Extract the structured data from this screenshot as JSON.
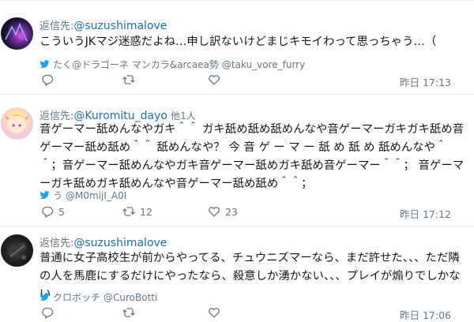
{
  "tweets": [
    {
      "reply_prefix": "返信先:",
      "reply_handle": "@suzushimalove",
      "reply_more": "",
      "text": "こういうJKマジ迷惑だよね…申し訳ないけどまじキモイわって思っちゃう…（",
      "source_name": "たく@ドラゴーネ マンカラ&arcaea勢",
      "source_handle": "@taku_vore_furry",
      "reply_count": "",
      "retweet_count": "",
      "like_count": "",
      "time": "昨日 17:13"
    },
    {
      "reply_prefix": "返信先:",
      "reply_handle": "@Kuromitu_dayo",
      "reply_more": "他1人",
      "text": "音ゲーマー舐めんなやガキ＾＾ ガキ舐め舐め舐めんなや音ゲーマーガキガキ舐め音ゲーマー舐め舐め＾＾ 舐めんなや？ 今 音 ゲ ー マ ー 舐 め 舐 め 舐めんなや＾＾；音ゲーマー舐めんなやガキ音ゲーマー舐めガキ舐め音ゲーマー＾＾； 音ゲーマーガキ舐めガキ舐めんなや音ゲーマー舐め舐め＾＾；",
      "source_name": "う",
      "source_handle": "@M0mijI_A0I",
      "reply_count": "5",
      "retweet_count": "12",
      "like_count": "23",
      "time": "昨日 17:12"
    },
    {
      "reply_prefix": "返信先:",
      "reply_handle": "@suzushimalove",
      "reply_more": "",
      "text": "普通に女子高校生が前からやってる、チュウニズマーなら、まだ許せた、、、ただ隣の人を馬鹿にするだけにやったなら、殺意しか湧かない、、、プレイが煽りでしかない",
      "source_name": "クロボッチ",
      "source_handle": "@CuroBotti",
      "reply_count": "",
      "retweet_count": "",
      "like_count": "",
      "time": "昨日 17:06"
    }
  ],
  "icons": {
    "reply": "reply-icon",
    "retweet": "retweet-icon",
    "like": "heart-icon",
    "source": "twitter-bird-icon"
  },
  "colors": {
    "handle_blue": "#1d6fb8",
    "twitter_blue": "#1da1f2",
    "muted": "#657786",
    "divider": "#e6ecf0"
  }
}
